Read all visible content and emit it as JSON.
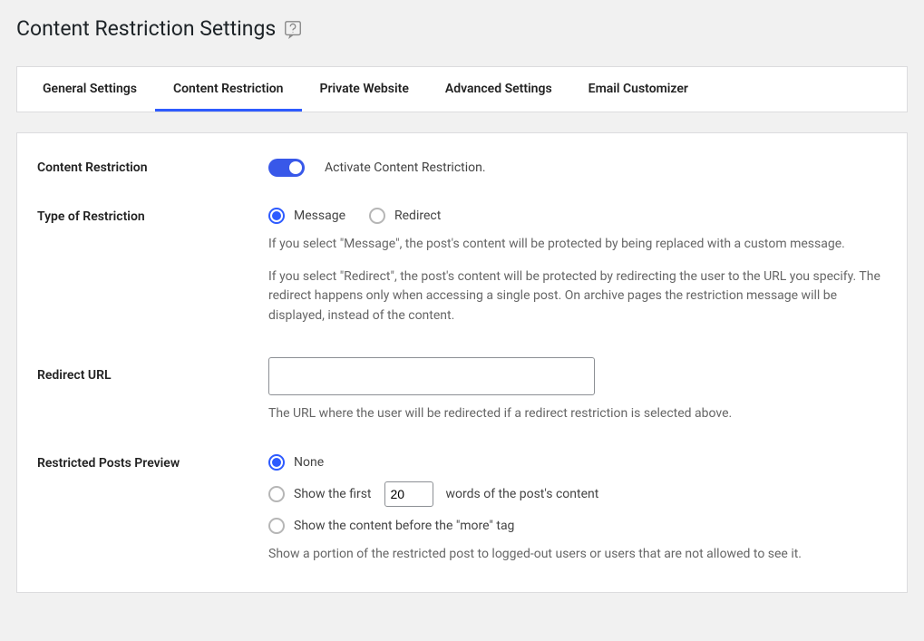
{
  "page": {
    "title": "Content Restriction Settings"
  },
  "tabs": [
    {
      "label": "General Settings"
    },
    {
      "label": "Content Restriction"
    },
    {
      "label": "Private Website"
    },
    {
      "label": "Advanced Settings"
    },
    {
      "label": "Email Customizer"
    }
  ],
  "fields": {
    "content_restriction": {
      "label": "Content Restriction",
      "activate_label": "Activate Content Restriction."
    },
    "type_of_restriction": {
      "label": "Type of Restriction",
      "options": {
        "message": "Message",
        "redirect": "Redirect"
      },
      "desc1": "If you select \"Message\", the post's content will be protected by being replaced with a custom message.",
      "desc2": "If you select \"Redirect\", the post's content will be protected by redirecting the user to the URL you specify. The redirect happens only when accessing a single post. On archive pages the restriction message will be displayed, instead of the content."
    },
    "redirect_url": {
      "label": "Redirect URL",
      "value": "",
      "desc": "The URL where the user will be redirected if a redirect restriction is selected above."
    },
    "preview": {
      "label": "Restricted Posts Preview",
      "option_none": "None",
      "option_first_pre": "Show the first",
      "option_first_value": "20",
      "option_first_post": "words of the post's content",
      "option_more": "Show the content before the \"more\" tag",
      "desc": "Show a portion of the restricted post to logged-out users or users that are not allowed to see it."
    }
  }
}
